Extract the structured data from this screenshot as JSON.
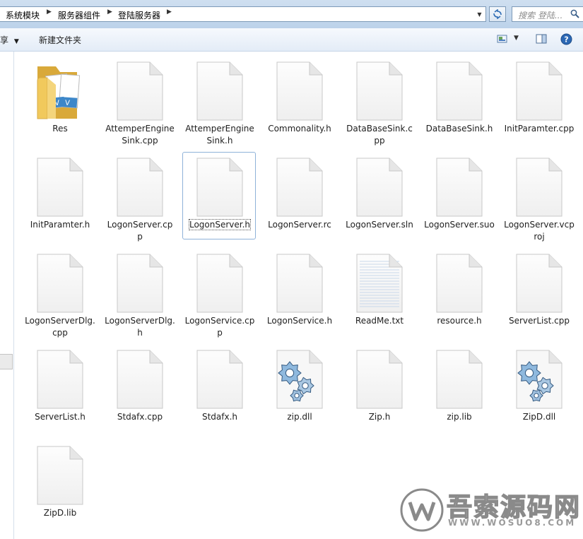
{
  "address_bar": {
    "breadcrumbs": [
      "系统模块",
      "服务器组件",
      "登陆服务器"
    ],
    "search_placeholder": "搜索 登陆..."
  },
  "toolbar": {
    "share_label": "享",
    "new_folder_label": "新建文件夹"
  },
  "files": [
    {
      "name": "Res",
      "icon": "folder-icon"
    },
    {
      "name": "AttemperEngineSink.cpp",
      "icon": "document-icon"
    },
    {
      "name": "AttemperEngineSink.h",
      "icon": "document-icon"
    },
    {
      "name": "Commonality.h",
      "icon": "document-icon"
    },
    {
      "name": "DataBaseSink.cpp",
      "icon": "document-icon"
    },
    {
      "name": "DataBaseSink.h",
      "icon": "document-icon"
    },
    {
      "name": "InitParamter.cpp",
      "icon": "document-icon"
    },
    {
      "name": "InitParamter.h",
      "icon": "document-icon"
    },
    {
      "name": "LogonServer.cpp",
      "icon": "document-icon"
    },
    {
      "name": "LogonServer.h",
      "icon": "document-icon",
      "focused": true
    },
    {
      "name": "LogonServer.rc",
      "icon": "document-icon"
    },
    {
      "name": "LogonServer.sln",
      "icon": "document-icon"
    },
    {
      "name": "LogonServer.suo",
      "icon": "document-icon"
    },
    {
      "name": "LogonServer.vcproj",
      "icon": "document-icon"
    },
    {
      "name": "LogonServerDlg.cpp",
      "icon": "document-icon"
    },
    {
      "name": "LogonServerDlg.h",
      "icon": "document-icon"
    },
    {
      "name": "LogonService.cpp",
      "icon": "document-icon"
    },
    {
      "name": "LogonService.h",
      "icon": "document-icon"
    },
    {
      "name": "ReadMe.txt",
      "icon": "text-document-icon"
    },
    {
      "name": "resource.h",
      "icon": "document-icon"
    },
    {
      "name": "ServerList.cpp",
      "icon": "document-icon"
    },
    {
      "name": "ServerList.h",
      "icon": "document-icon"
    },
    {
      "name": "Stdafx.cpp",
      "icon": "document-icon"
    },
    {
      "name": "Stdafx.h",
      "icon": "document-icon"
    },
    {
      "name": "zip.dll",
      "icon": "dll-gear-icon"
    },
    {
      "name": "Zip.h",
      "icon": "document-icon"
    },
    {
      "name": "zip.lib",
      "icon": "document-icon"
    },
    {
      "name": "ZipD.dll",
      "icon": "dll-gear-icon"
    },
    {
      "name": "ZipD.lib",
      "icon": "document-icon"
    }
  ],
  "watermark": {
    "text": "吾索源码网",
    "url": "WWW.WOSUO8.COM"
  },
  "colors": {
    "selection_border": "#8fb2d9",
    "toolbar_bg": "#e3ecf7",
    "folder_yellow": "#f1c95c"
  }
}
